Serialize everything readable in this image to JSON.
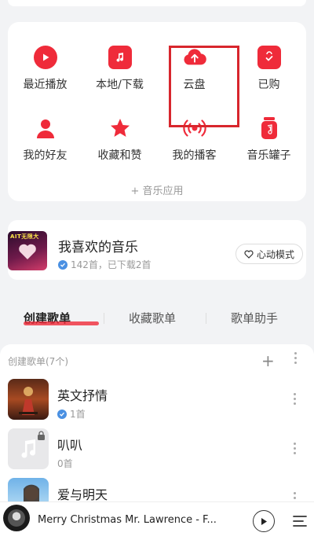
{
  "apps": [
    {
      "id": "recent",
      "label": "最近播放",
      "icon": "play-icon"
    },
    {
      "id": "local",
      "label": "本地/下载",
      "icon": "music-note-icon"
    },
    {
      "id": "cloud",
      "label": "云盘",
      "icon": "cloud-upload-icon"
    },
    {
      "id": "purchased",
      "label": "已购",
      "icon": "bag-check-icon"
    },
    {
      "id": "friends",
      "label": "我的好友",
      "icon": "person-icon"
    },
    {
      "id": "collect",
      "label": "收藏和赞",
      "icon": "star-icon"
    },
    {
      "id": "podcast",
      "label": "我的播客",
      "icon": "broadcast-icon"
    },
    {
      "id": "jar",
      "label": "音乐罐子",
      "icon": "jar-icon"
    }
  ],
  "add_app_label": "+ 音乐应用",
  "favorite": {
    "title": "我喜欢的音乐",
    "subtitle": "142首，已下载2首",
    "cover_badge": "AIT无限大",
    "mode_button": "心动模式"
  },
  "tabs": [
    {
      "label": "创建歌单",
      "active": true
    },
    {
      "label": "收藏歌单",
      "active": false
    },
    {
      "label": "歌单助手",
      "active": false
    }
  ],
  "list_header": "创建歌单(7个)",
  "playlists": [
    {
      "name": "英文抒情",
      "count": "1首",
      "verified": true
    },
    {
      "name": "叭叭",
      "count": "0首",
      "verified": false,
      "locked": true
    },
    {
      "name": "爱与明天",
      "count": "",
      "verified": false
    }
  ],
  "player": {
    "song": "Merry Christmas Mr. Lawrence - F..."
  },
  "colors": {
    "accent": "#ef2b3a",
    "highlight": "#d8262d",
    "background": "#f2f3f5"
  }
}
